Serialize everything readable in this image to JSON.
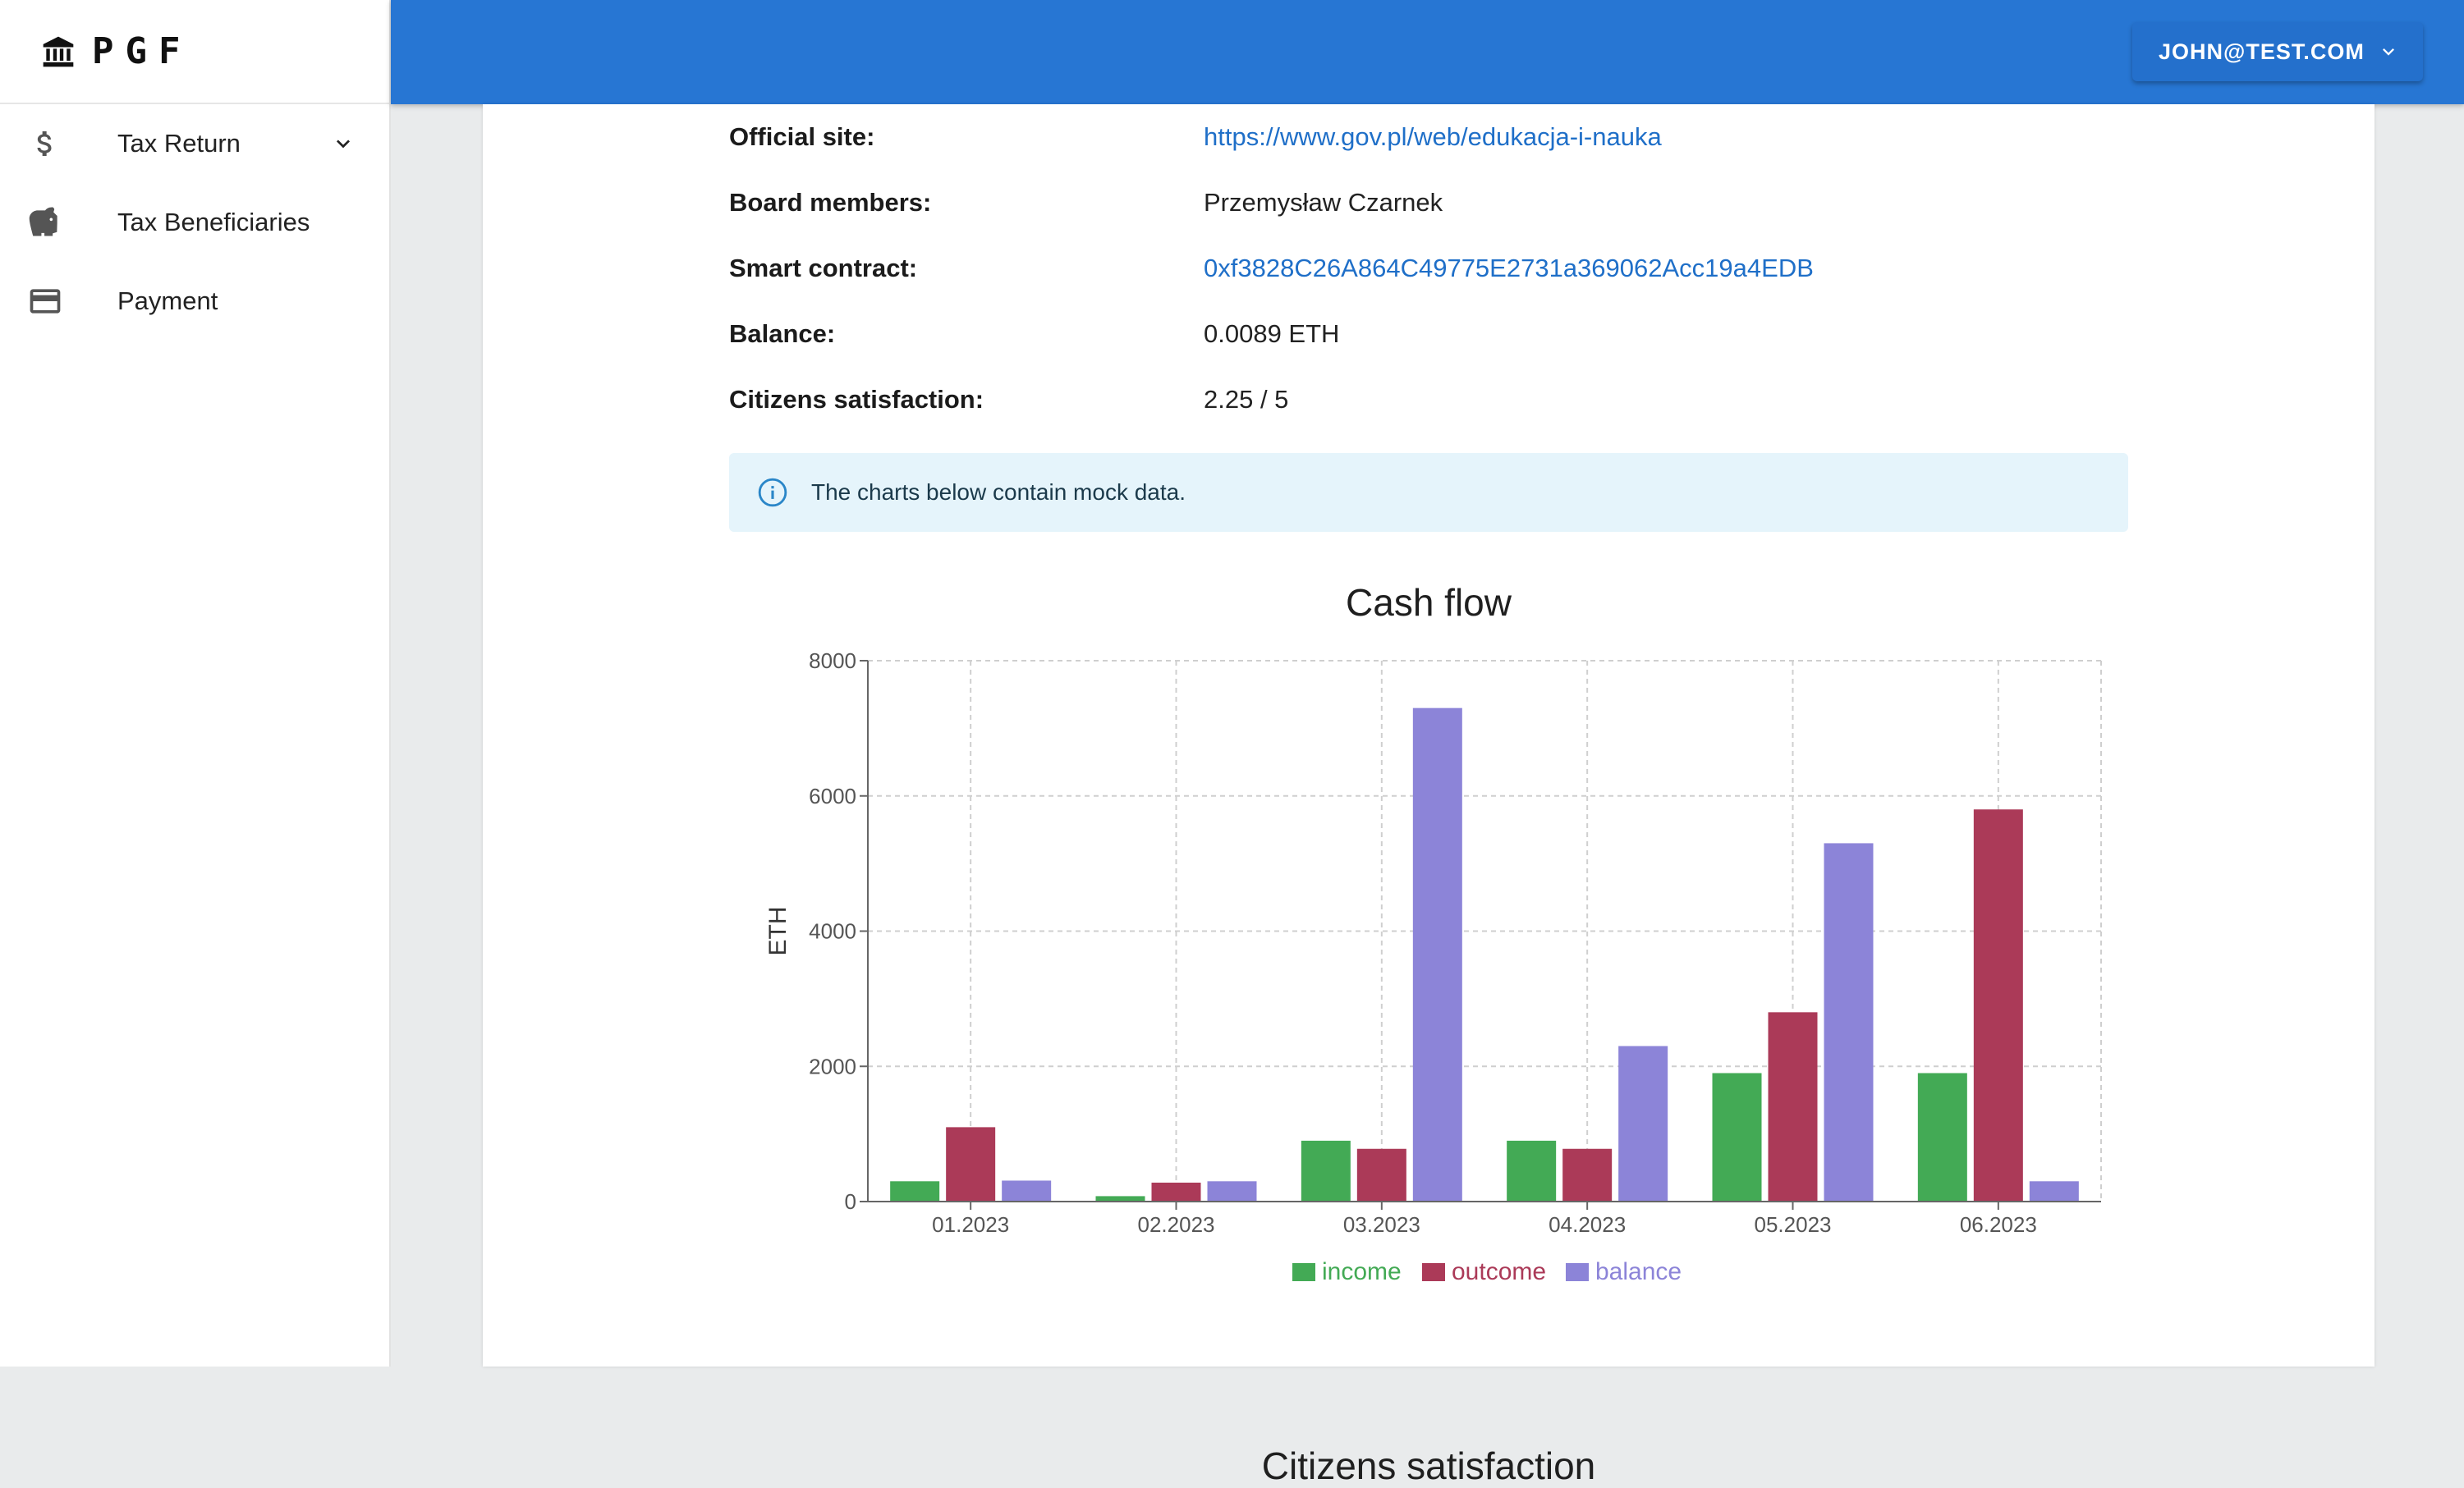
{
  "brand": {
    "name": "PGF",
    "logo_icon": "bank-icon"
  },
  "sidebar": {
    "items": [
      {
        "label": "Tax Return",
        "icon": "dollar-icon",
        "expandable": true
      },
      {
        "label": "Tax Beneficiaries",
        "icon": "piggy-bank-icon"
      },
      {
        "label": "Payment",
        "icon": "credit-card-icon"
      }
    ]
  },
  "header": {
    "user_email": "JOHN@TEST.COM",
    "color": "#2776d3"
  },
  "details": {
    "official_site_label": "Official site:",
    "official_site_value": "https://www.gov.pl/web/edukacja-i-nauka",
    "board_label": "Board members:",
    "board_value": "Przemysław Czarnek",
    "contract_label": "Smart contract:",
    "contract_value": "0xf3828C26A864C49775E2731a369062Acc19a4EDB",
    "balance_label": "Balance:",
    "balance_value": "0.0089 ETH",
    "satisfaction_label": "Citizens satisfaction:",
    "satisfaction_value": "2.25 / 5"
  },
  "alert": {
    "text": "The charts below contain mock data.",
    "icon": "info-icon"
  },
  "second_section_title": "Citizens satisfaction",
  "chart_data": {
    "type": "bar",
    "title": "Cash flow",
    "xlabel": "",
    "ylabel": "ETH",
    "ylim": [
      0,
      8000
    ],
    "yticks": [
      0,
      2000,
      4000,
      6000,
      8000
    ],
    "grid": true,
    "legend_position": "bottom",
    "categories": [
      "01.2023",
      "02.2023",
      "03.2023",
      "04.2023",
      "05.2023",
      "06.2023"
    ],
    "series": [
      {
        "name": "income",
        "color": "#43aa55",
        "values": [
          300,
          80,
          900,
          900,
          1900,
          1900
        ]
      },
      {
        "name": "outcome",
        "color": "#ab3a58",
        "values": [
          1100,
          280,
          780,
          780,
          2800,
          5800
        ]
      },
      {
        "name": "balance",
        "color": "#8c84d8",
        "values": [
          310,
          300,
          7300,
          2300,
          5300,
          300
        ]
      }
    ]
  }
}
